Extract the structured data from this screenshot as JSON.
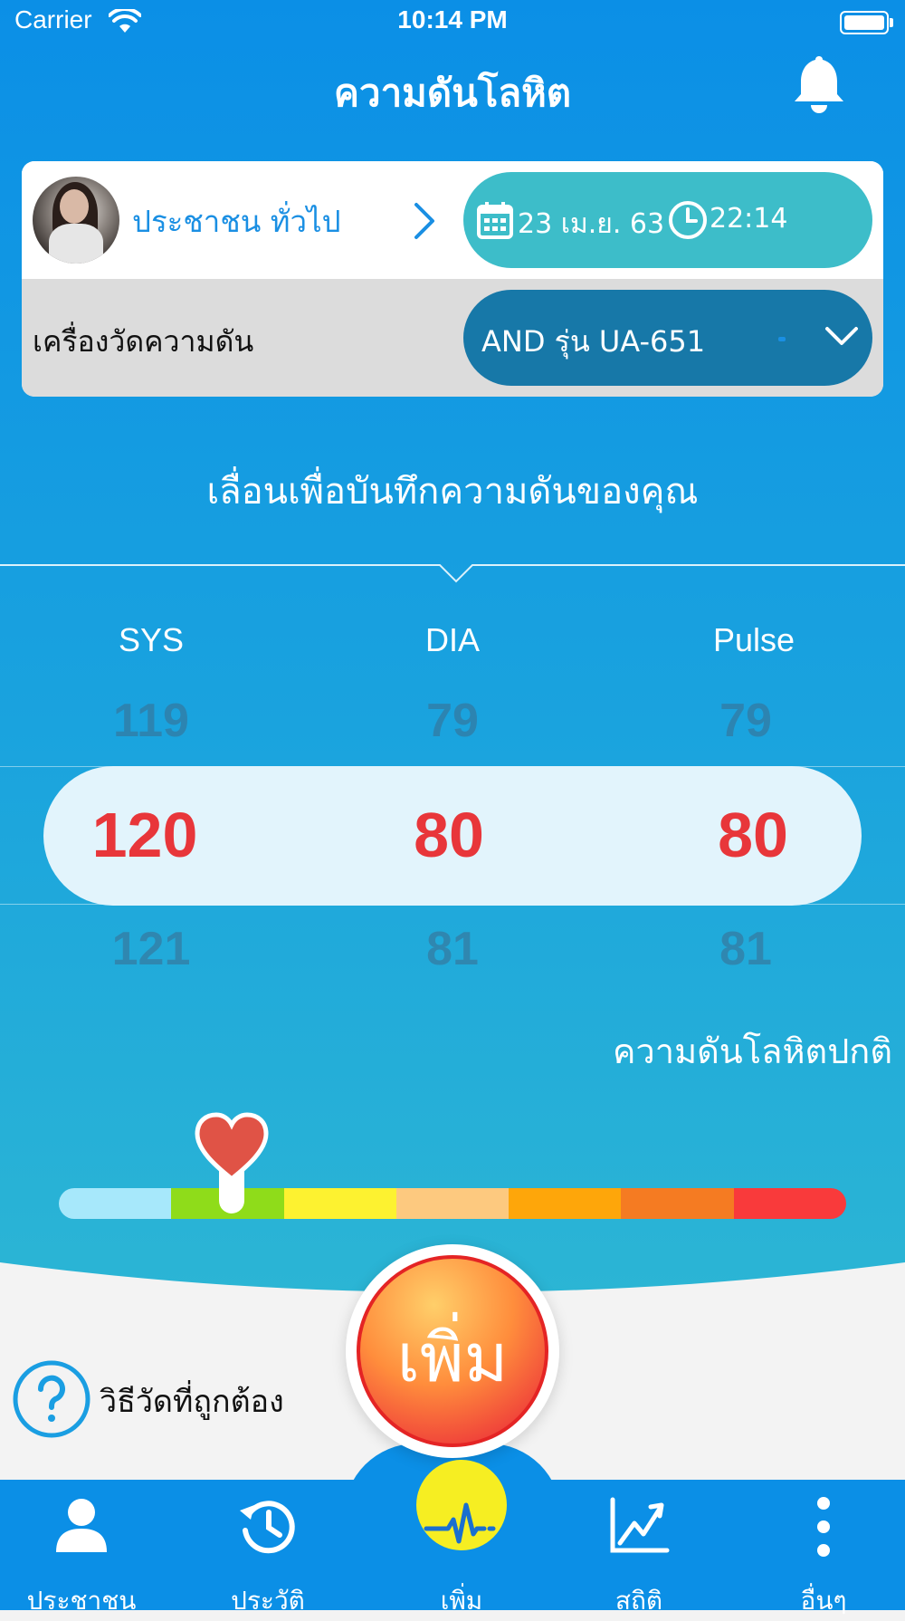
{
  "status_bar": {
    "carrier": "Carrier",
    "time": "10:14 PM"
  },
  "header": {
    "title": "ความดันโลหิต"
  },
  "profile": {
    "name": "ประชาชน ทั่วไป"
  },
  "datetime": {
    "date": "23 เม.ย. 63",
    "time": "22:14"
  },
  "device": {
    "label": "เครื่องวัดความดัน",
    "value": "AND รุ่น UA-651"
  },
  "instruction": "เลื่อนเพื่อบันทึกความดันของคุณ",
  "picker": {
    "columns": [
      {
        "label": "SYS",
        "above": "119",
        "value": "120",
        "below": "121"
      },
      {
        "label": "DIA",
        "above": "79",
        "value": "80",
        "below": "81"
      },
      {
        "label": "Pulse",
        "above": "79",
        "value": "80",
        "below": "81"
      }
    ]
  },
  "pressure_status": "ความดันโลหิตปกติ",
  "scale": {
    "colors": [
      "#a7e8fb",
      "#8fdc1a",
      "#fdf230",
      "#fdc97f",
      "#fea60a",
      "#f57b22",
      "#f93a3b"
    ],
    "marker_position": 0.22
  },
  "help": {
    "label": "วิธีวัดที่ถูกต้อง"
  },
  "add_button": {
    "label": "เพิ่ม"
  },
  "tabs": [
    {
      "label": "ประชาชน",
      "icon": "person-icon"
    },
    {
      "label": "ประวัติ",
      "icon": "history-icon"
    },
    {
      "label": "เพิ่ม",
      "icon": "heartbeat-icon"
    },
    {
      "label": "สถิติ",
      "icon": "chart-icon"
    },
    {
      "label": "อื่นๆ",
      "icon": "more-icon"
    }
  ],
  "colors": {
    "primary_blue": "#0b8fe6",
    "accent_red": "#e8363a",
    "teal": "#3dbdc9",
    "device_blue": "#1778a8"
  }
}
